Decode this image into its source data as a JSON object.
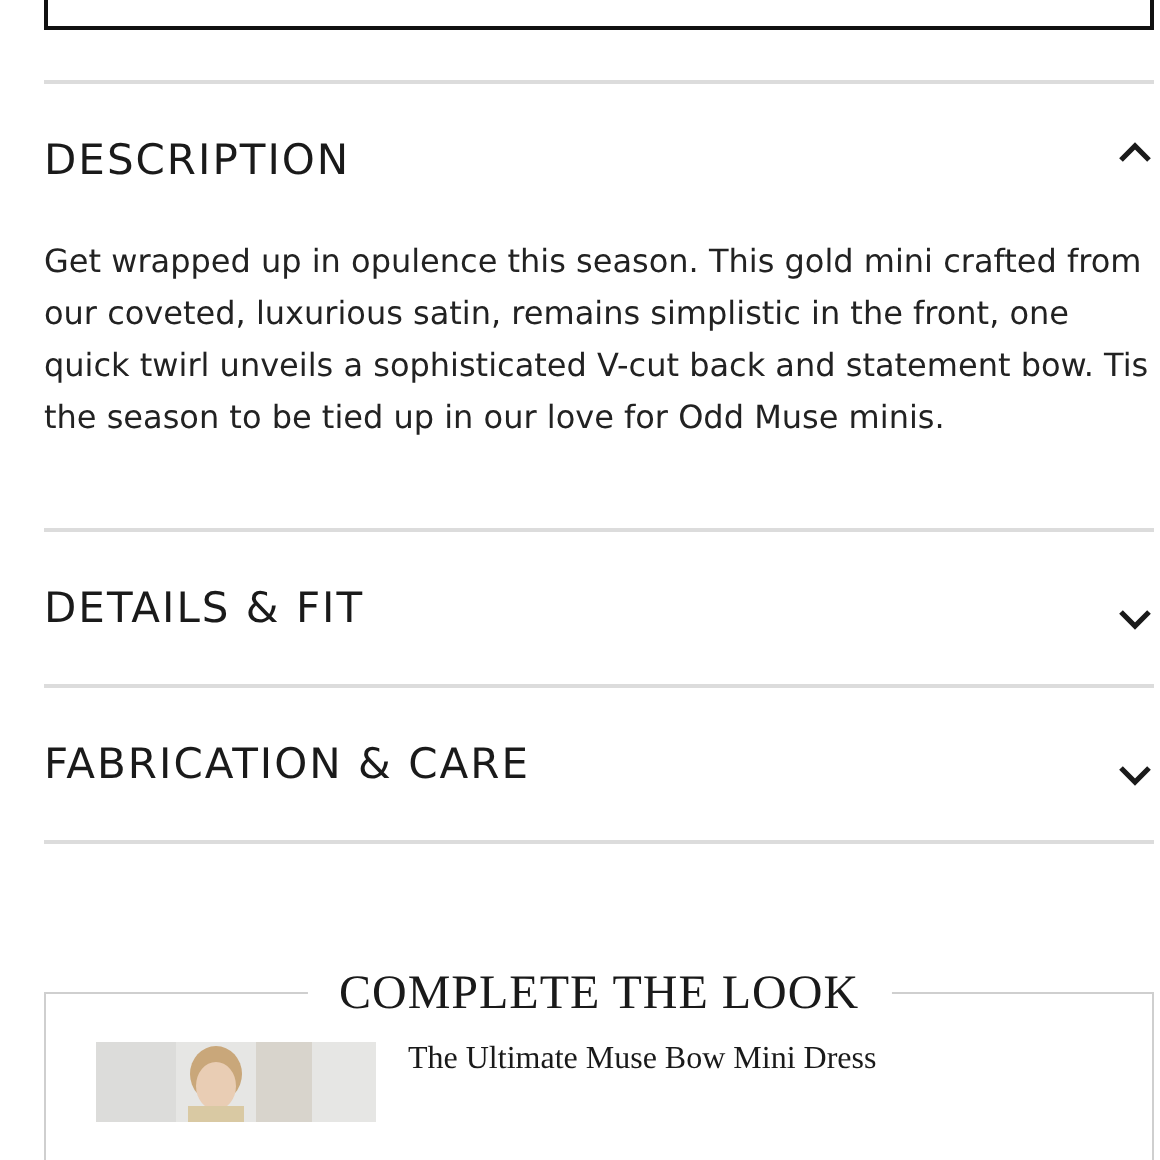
{
  "sections": [
    {
      "title": "DESCRIPTION",
      "expanded": true,
      "body": "Get wrapped up in opulence this season. This gold mini crafted from our coveted, luxurious satin, remains simplistic in the front, one quick twirl unveils a sophisticated V-cut back and statement bow. Tis the season to be tied up in our love for Odd Muse minis."
    },
    {
      "title": "DETAILS & FIT",
      "expanded": false
    },
    {
      "title": "FABRICATION & CARE",
      "expanded": false
    }
  ],
  "complete_the_look": {
    "heading": "COMPLETE THE LOOK",
    "products": [
      {
        "name": "The Ultimate Muse Bow Mini Dress",
        "kind": "picture"
      }
    ]
  }
}
